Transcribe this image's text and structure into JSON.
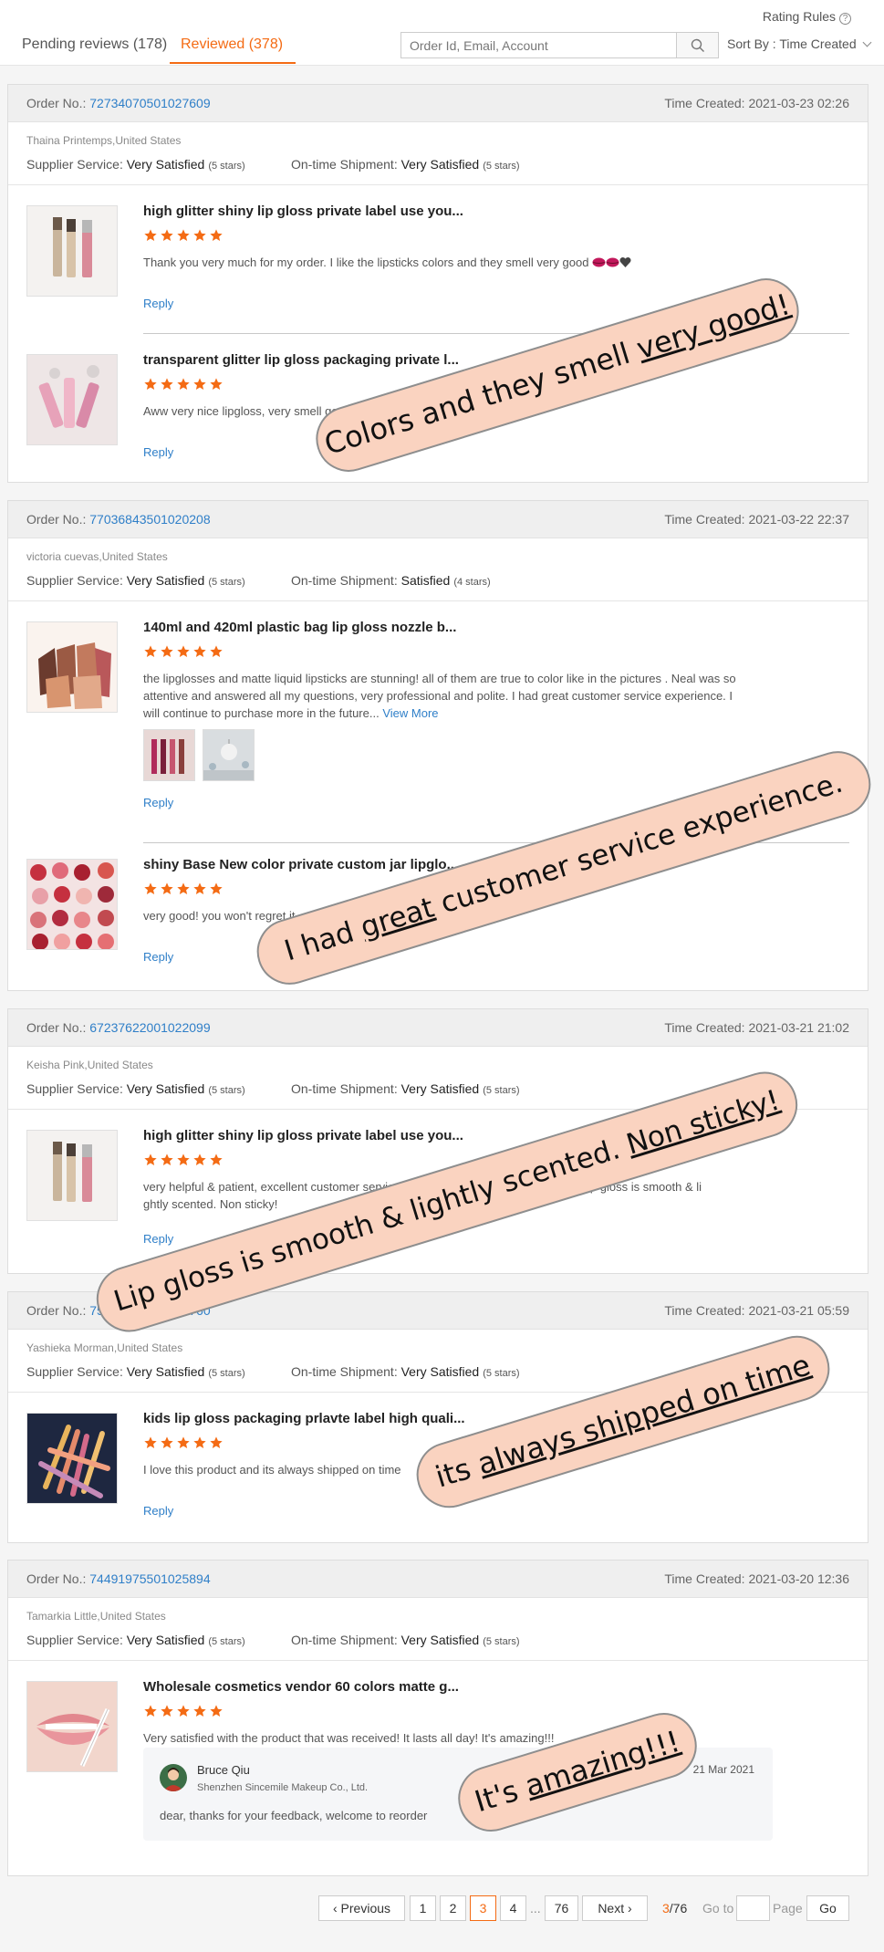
{
  "header": {
    "rating_rules": "Rating Rules",
    "tabs": [
      {
        "label": "Pending reviews (178)",
        "active": false
      },
      {
        "label": "Reviewed (378)",
        "active": true
      }
    ],
    "search_placeholder": "Order Id, Email, Account",
    "sort_label": "Sort By : Time Created"
  },
  "labels": {
    "order_no": "Order No.:",
    "time_created": "Time Created:",
    "supplier_service": "Supplier Service:",
    "ontime_shipment": "On-time Shipment:",
    "reply": "Reply",
    "view_more": "View More"
  },
  "orders": [
    {
      "order_no": "72734070501027609",
      "time": "2021-03-23 02:26",
      "buyer": "Thaina Printemps,United States",
      "supplier_service": "Very Satisfied",
      "supplier_stars": "(5 stars)",
      "shipment": "Very Satisfied",
      "shipment_stars": "(5 stars)",
      "items": [
        {
          "name": "high glitter shiny lip gloss private label use you...",
          "rating": 5,
          "text": "Thank you very much for my order. I like the lipsticks colors and they smell very good"
        },
        {
          "name": "transparent glitter lip gloss packaging private l...",
          "rating": 5,
          "text": "Aww very nice lipgloss, very smell good"
        }
      ]
    },
    {
      "order_no": "77036843501020208",
      "time": "2021-03-22 22:37",
      "buyer": "victoria cuevas,United States",
      "supplier_service": "Very Satisfied",
      "supplier_stars": "(5 stars)",
      "shipment": "Satisfied",
      "shipment_stars": "(4 stars)",
      "items": [
        {
          "name": "140ml and 420ml plastic bag lip gloss nozzle b...",
          "rating": 5,
          "text": "the lipglosses and matte liquid lipsticks are stunning! all of them are true to color like in the pictures . Neal was so attentive and answered all my questions, very professional and polite. I had  great customer service experience. I will continue to purchase more in the future..."
        },
        {
          "name": "shiny Base New color private custom jar lipglo...",
          "rating": 5,
          "text": "very good! you won't regret it"
        }
      ]
    },
    {
      "order_no": "67237622001022099",
      "time": "2021-03-21 21:02",
      "buyer": "Keisha Pink,United States",
      "supplier_service": "Very Satisfied",
      "supplier_stars": "(5 stars)",
      "shipment": "Very Satisfied",
      "shipment_stars": "(5 stars)",
      "items": [
        {
          "name": "high glitter shiny lip gloss private label use you...",
          "rating": 5,
          "text_line1": "very helpful & patient, excellent customer service and fast delivery & great product! Lip gloss is smooth & li",
          "text_line2": "ghtly scented. Non sticky!"
        }
      ]
    },
    {
      "order_no": "75788491501027760",
      "time": "2021-03-21 05:59",
      "buyer": "Yashieka Morman,United States",
      "supplier_service": "Very Satisfied",
      "supplier_stars": "(5 stars)",
      "shipment": "Very Satisfied",
      "shipment_stars": "(5 stars)",
      "items": [
        {
          "name": "kids lip gloss packaging prlavte label high quali...",
          "rating": 5,
          "text": "I love this product and its always shipped on time"
        }
      ]
    },
    {
      "order_no": "74491975501025894",
      "time": "2021-03-20 12:36",
      "buyer": "Tamarkia Little,United States",
      "supplier_service": "Very Satisfied",
      "supplier_stars": "(5 stars)",
      "shipment": "Very Satisfied",
      "shipment_stars": "(5 stars)",
      "items": [
        {
          "name": "Wholesale cosmetics vendor 60 colors matte g...",
          "rating": 5,
          "text": "Very satisfied with the product that was received! It lasts all day! It's amazing!!!"
        }
      ],
      "seller_reply": {
        "name": "Bruce Qiu",
        "company": "Shenzhen Sincemile Makeup Co., Ltd.",
        "date": "21 Mar 2021",
        "text": "dear, thanks for your feedback, welcome to reorder"
      }
    }
  ],
  "pagination": {
    "previous": "Previous",
    "pages": [
      "1",
      "2",
      "3",
      "4"
    ],
    "ellipsis": "...",
    "last": "76",
    "next": "Next",
    "current": "3",
    "total": "/76",
    "goto": "Go to",
    "page_word": "Page",
    "go": "Go"
  },
  "overlays": [
    {
      "pre": "Colors and they smell ",
      "u": "very good!",
      "post": ""
    },
    {
      "pre": "I had  ",
      "u": "great",
      "post": " customer service experience."
    },
    {
      "pre": "Lip gloss is smooth & lightly scented. ",
      "u": "Non sticky!",
      "post": ""
    },
    {
      "pre": "its ",
      "u": "always shipped on time",
      "post": ""
    },
    {
      "pre": "It's ",
      "u": "amazing!!!",
      "post": ""
    }
  ],
  "colors": {
    "accent": "#f46b14",
    "link": "#2f7fc8",
    "banner_fill": "#fad3c0"
  }
}
